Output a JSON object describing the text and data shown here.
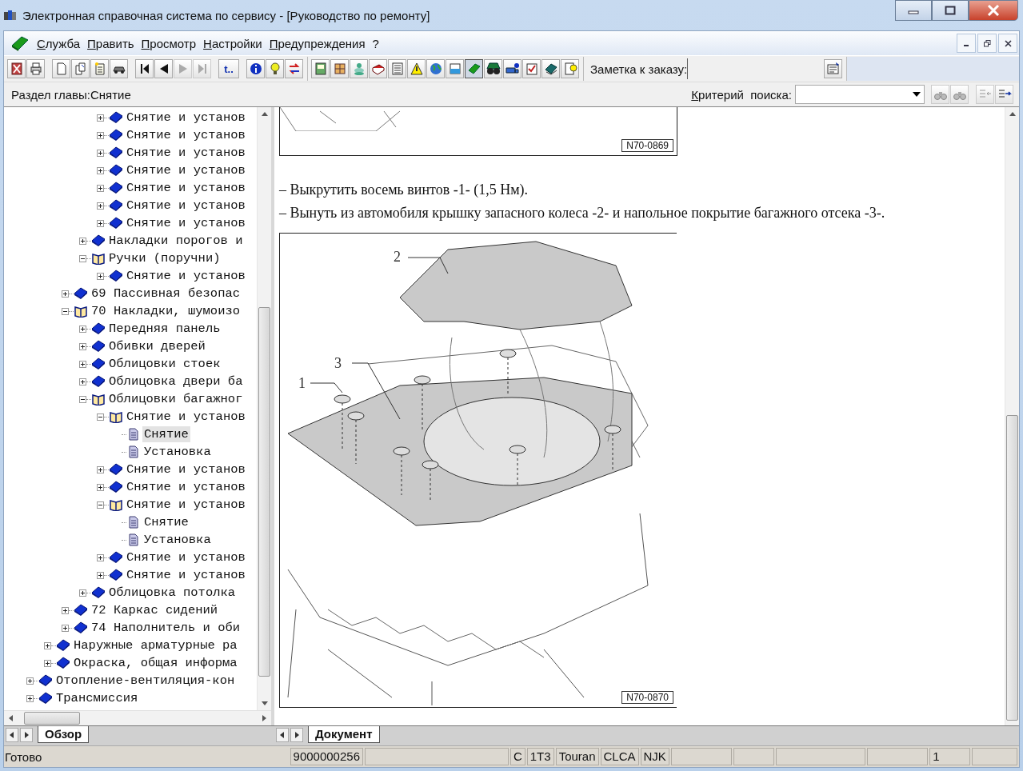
{
  "window": {
    "title": "Электронная справочная система по сервису - [Руководство по ремонту]"
  },
  "menu": [
    "Служба",
    "Править",
    "Просмотр",
    "Настройки",
    "Предупреждения",
    "?"
  ],
  "toolbar": {
    "goto_label": "t..",
    "navigation": [
      {
        "disabled": false
      },
      {
        "disabled": false
      },
      {
        "disabled": true
      },
      {
        "disabled": true
      }
    ],
    "note_label": "Заметка к заказу:"
  },
  "section": {
    "label": "Раздел главы:Снятие",
    "search_label": "Критерий  поиска:"
  },
  "tree": {
    "items": [
      {
        "children": [
          {
            "children": [
              {
                "children": [
                  {
                    "children": [
                      {
                        "label": "Снятие и установ",
                        "kind": "chapter",
                        "expanded": false,
                        "selected": false
                      },
                      {
                        "label": "Снятие и установ",
                        "kind": "chapter",
                        "expanded": false,
                        "selected": false
                      },
                      {
                        "label": "Снятие и установ",
                        "kind": "chapter",
                        "expanded": false,
                        "selected": false
                      },
                      {
                        "label": "Снятие и установ",
                        "kind": "chapter",
                        "expanded": false,
                        "selected": false
                      },
                      {
                        "label": "Снятие и установ",
                        "kind": "chapter",
                        "expanded": false,
                        "selected": false
                      },
                      {
                        "label": "Снятие и установ",
                        "kind": "chapter",
                        "expanded": false,
                        "selected": false
                      },
                      {
                        "label": "Снятие и установ",
                        "kind": "chapter",
                        "expanded": false,
                        "selected": false
                      }
                    ]
                  },
                  {
                    "label": "Накладки порогов и",
                    "kind": "chapter",
                    "expanded": false,
                    "selected": false
                  },
                  {
                    "label": "Ручки (поручни)",
                    "kind": "chapter",
                    "expanded": true,
                    "selected": false,
                    "children": [
                      {
                        "label": "Снятие и установ",
                        "kind": "chapter",
                        "expanded": false,
                        "selected": false
                      }
                    ]
                  }
                ]
              },
              {
                "label": "69 Пассивная безопас",
                "kind": "chapter",
                "expanded": false,
                "selected": false
              },
              {
                "label": "70 Накладки, шумоизо",
                "kind": "chapter",
                "expanded": true,
                "selected": false,
                "children": [
                  {
                    "label": "Передняя панель",
                    "kind": "chapter",
                    "expanded": false,
                    "selected": false
                  },
                  {
                    "label": "Обивки дверей",
                    "kind": "chapter",
                    "expanded": false,
                    "selected": false
                  },
                  {
                    "label": "Облицовки стоек",
                    "kind": "chapter",
                    "expanded": false,
                    "selected": false
                  },
                  {
                    "label": "Облицовка двери ба",
                    "kind": "chapter",
                    "expanded": false,
                    "selected": false
                  },
                  {
                    "label": "Облицовки багажног",
                    "kind": "chapter",
                    "expanded": true,
                    "selected": false,
                    "children": [
                      {
                        "label": "Снятие и установ",
                        "kind": "chapter",
                        "expanded": true,
                        "selected": false,
                        "children": [
                          {
                            "label": "Снятие",
                            "kind": "page",
                            "selected": true
                          },
                          {
                            "label": "Установка",
                            "kind": "page",
                            "selected": false
                          }
                        ]
                      },
                      {
                        "label": "Снятие и установ",
                        "kind": "chapter",
                        "expanded": false,
                        "selected": false
                      },
                      {
                        "label": "Снятие и установ",
                        "kind": "chapter",
                        "expanded": false,
                        "selected": false
                      },
                      {
                        "label": "Снятие и установ",
                        "kind": "chapter",
                        "expanded": true,
                        "selected": false,
                        "children": [
                          {
                            "label": "Снятие",
                            "kind": "page",
                            "selected": false
                          },
                          {
                            "label": "Установка",
                            "kind": "page",
                            "selected": false
                          }
                        ]
                      },
                      {
                        "label": "Снятие и установ",
                        "kind": "chapter",
                        "expanded": false,
                        "selected": false
                      },
                      {
                        "label": "Снятие и установ",
                        "kind": "chapter",
                        "expanded": false,
                        "selected": false
                      }
                    ]
                  },
                  {
                    "label": "Облицовка потолка",
                    "kind": "chapter",
                    "expanded": false,
                    "selected": false
                  }
                ]
              },
              {
                "label": "72 Каркас сидений",
                "kind": "chapter",
                "expanded": false,
                "selected": false
              },
              {
                "label": "74 Наполнитель и оби",
                "kind": "chapter",
                "expanded": false,
                "selected": false
              }
            ]
          },
          {
            "label": "Наружные арматурные ра",
            "kind": "chapter",
            "expanded": false,
            "selected": false
          },
          {
            "label": "Окраска, общая информа",
            "kind": "chapter",
            "expanded": false,
            "selected": false
          }
        ]
      },
      {
        "label": "Отопление-вентиляция-кон",
        "kind": "chapter",
        "expanded": false,
        "selected": false
      },
      {
        "label": "Трансмиссия",
        "kind": "chapter",
        "expanded": false,
        "selected": false
      }
    ]
  },
  "left_tabs": [
    {
      "label": "Обзор",
      "selected": true
    }
  ],
  "document": {
    "top_figure": {
      "code": "N70-0869"
    },
    "steps": [
      "–  Выкрутить восемь винтов -1- (1,5 Нм).",
      "–  Вынуть из автомобиля крышку запасного колеса -2- и напольное покрытие багажного отсека -3-."
    ],
    "figure": {
      "code": "N70-0870",
      "callouts": [
        "2",
        "3",
        "1"
      ]
    }
  },
  "right_tabs": [
    {
      "label": "Документ",
      "selected": true
    }
  ],
  "status_bar": {
    "left": "Готово",
    "cells": [
      "9000000256",
      "",
      "C",
      "1T3",
      "Touran",
      "CLCA",
      "NJK",
      "",
      "",
      "",
      "",
      "1",
      ""
    ]
  }
}
